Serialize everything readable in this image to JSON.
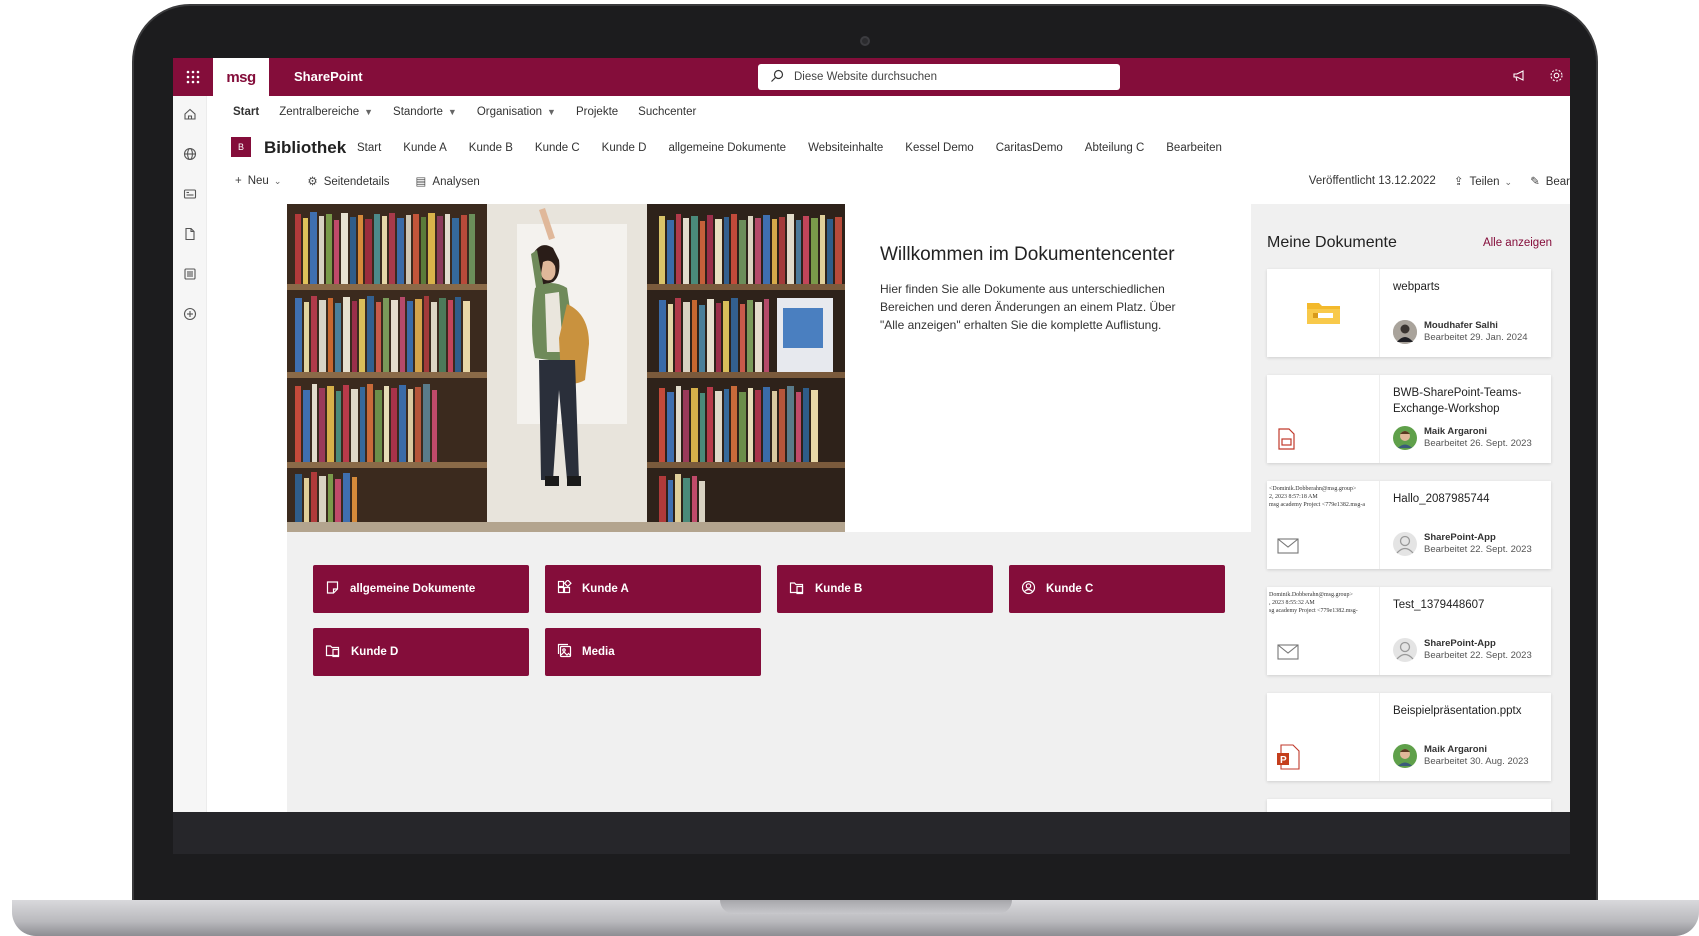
{
  "suitebar": {
    "logo": "msg",
    "app_name": "SharePoint",
    "search_placeholder": "Diese Website durchsuchen"
  },
  "hubnav": [
    {
      "label": "Start",
      "active": true,
      "dropdown": false
    },
    {
      "label": "Zentralbereiche",
      "dropdown": true
    },
    {
      "label": "Standorte",
      "dropdown": true
    },
    {
      "label": "Organisation",
      "dropdown": true
    },
    {
      "label": "Projekte",
      "dropdown": false
    },
    {
      "label": "Suchcenter",
      "dropdown": false
    }
  ],
  "site": {
    "logo_letter": "B",
    "title": "Bibliothek",
    "nav": [
      "Start",
      "Kunde A",
      "Kunde B",
      "Kunde C",
      "Kunde D",
      "allgemeine Dokumente",
      "Websiteinhalte",
      "Kessel Demo",
      "CaritasDemo",
      "Abteilung C",
      "Bearbeiten"
    ]
  },
  "commandbar": {
    "new_label": "Neu",
    "details_label": "Seitendetails",
    "analytics_label": "Analysen",
    "published": "Veröffentlicht 13.12.2022",
    "share_label": "Teilen",
    "edit_label": "Bear"
  },
  "welcome": {
    "title": "Willkommen im Dokumentencenter",
    "text": "Hier finden Sie alle Dokumente aus unterschiedlichen Bereichen und deren Änderungen an einem Platz. Über \"Alle anzeigen\" erhalten Sie die komplette Auflistung."
  },
  "tiles": [
    {
      "label": "allgemeine Dokumente",
      "icon": "document-icon"
    },
    {
      "label": "Kunde A",
      "icon": "apps-icon"
    },
    {
      "label": "Kunde B",
      "icon": "folder-doc-icon"
    },
    {
      "label": "Kunde C",
      "icon": "person-circle-icon"
    },
    {
      "label": "Kunde D",
      "icon": "folder-doc-icon"
    },
    {
      "label": "Media",
      "icon": "images-icon"
    }
  ],
  "mydocs": {
    "title": "Meine Dokumente",
    "show_all": "Alle anzeigen",
    "items": [
      {
        "name": "webparts",
        "author": "Moudhafer Salhi",
        "edited": "Bearbeitet 29. Jan. 2024"
      },
      {
        "name": "BWB-SharePoint-Teams-Exchange-Workshop",
        "author": "Maik Argaroni",
        "edited": "Bearbeitet 26. Sept. 2023"
      },
      {
        "name": "Hallo_2087985744",
        "author": "SharePoint-App",
        "edited": "Bearbeitet 22. Sept. 2023",
        "thumb_lines": [
          "<Dominik.Dobberahn@msg.group>",
          "2, 2023 8:57:18 AM",
          "msg academy Project <779e1382.msg-a"
        ]
      },
      {
        "name": "Test_1379448607",
        "author": "SharePoint-App",
        "edited": "Bearbeitet 22. Sept. 2023",
        "thumb_lines": [
          "Dominik.Dobberahn@msg.group>",
          ", 2023 8:55:32 AM",
          "sg academy Project <779e1382.msg-"
        ]
      },
      {
        "name": "Beispielpräsentation.pptx",
        "author": "Maik Argaroni",
        "edited": "Bearbeitet 30. Aug. 2023"
      }
    ]
  },
  "colors": {
    "brand": "#840d3a"
  }
}
